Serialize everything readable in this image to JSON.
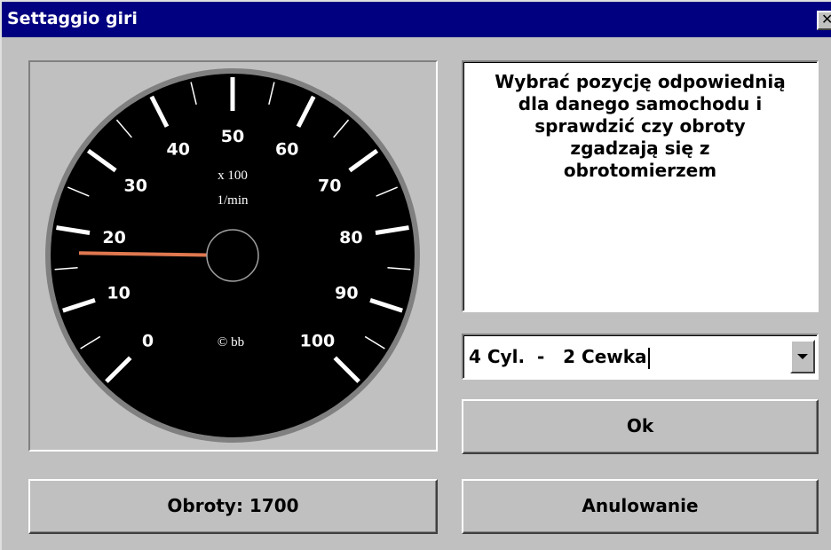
{
  "window": {
    "title": "Settaggio giri",
    "close_label": "✕"
  },
  "gauge": {
    "labels": [
      "0",
      "10",
      "20",
      "30",
      "40",
      "50",
      "60",
      "70",
      "80",
      "90",
      "100"
    ],
    "unit_line1": "x 100",
    "unit_line2": "1/min",
    "copyright": "© bb",
    "rpm_value": 1700,
    "scale_max": 10000,
    "colors": {
      "dial": "#000000",
      "rim": "#808080",
      "ticks": "#ffffff",
      "needle": "#e07850",
      "hub": "#a0a0a0"
    }
  },
  "info": {
    "lines": [
      "Wybrać pozycję odpowiednią",
      "dla danego samochodu i",
      "sprawdzić czy obroty",
      "zgadzają się z",
      "obrotomierzem"
    ]
  },
  "combo": {
    "selected": "4 Cyl.  -   2 Cewka",
    "arrow_icon": "chevron-down-icon"
  },
  "buttons": {
    "ok": "Ok",
    "cancel": "Anulowanie"
  },
  "status": {
    "rpm_label": "Obroty: 1700"
  },
  "colors": {
    "titlebar": "#000080",
    "face": "#c0c0c0"
  }
}
